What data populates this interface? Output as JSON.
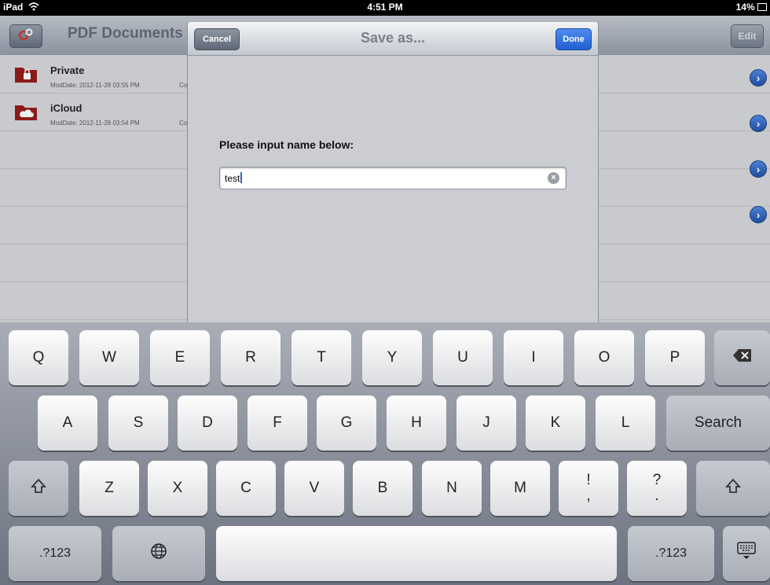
{
  "status_bar": {
    "left": "iPad",
    "time": "4:51 PM",
    "battery": "14%"
  },
  "background": {
    "title": "PDF Documents",
    "edit_label": "Edit",
    "rows": [
      {
        "name": "Private",
        "date": "ModDate: 2012-11-28 03:55 PM",
        "extra": "Co"
      },
      {
        "name": "iCloud",
        "date": "ModDate: 2012-11-28 03:54 PM",
        "extra": "Co"
      }
    ]
  },
  "dialog": {
    "title": "Save as...",
    "cancel_label": "Cancel",
    "done_label": "Done",
    "prompt": "Please input name below:",
    "input_value": "test"
  },
  "keyboard": {
    "row1": [
      "Q",
      "W",
      "E",
      "R",
      "T",
      "Y",
      "U",
      "I",
      "O",
      "P"
    ],
    "row2": [
      "A",
      "S",
      "D",
      "F",
      "G",
      "H",
      "J",
      "K",
      "L"
    ],
    "row3": [
      "Z",
      "X",
      "C",
      "V",
      "B",
      "N",
      "M"
    ],
    "search_label": "Search",
    "num_label": ".?123",
    "punct1_top": "!",
    "punct1_bottom": ",",
    "punct2_top": "?",
    "punct2_bottom": "."
  }
}
